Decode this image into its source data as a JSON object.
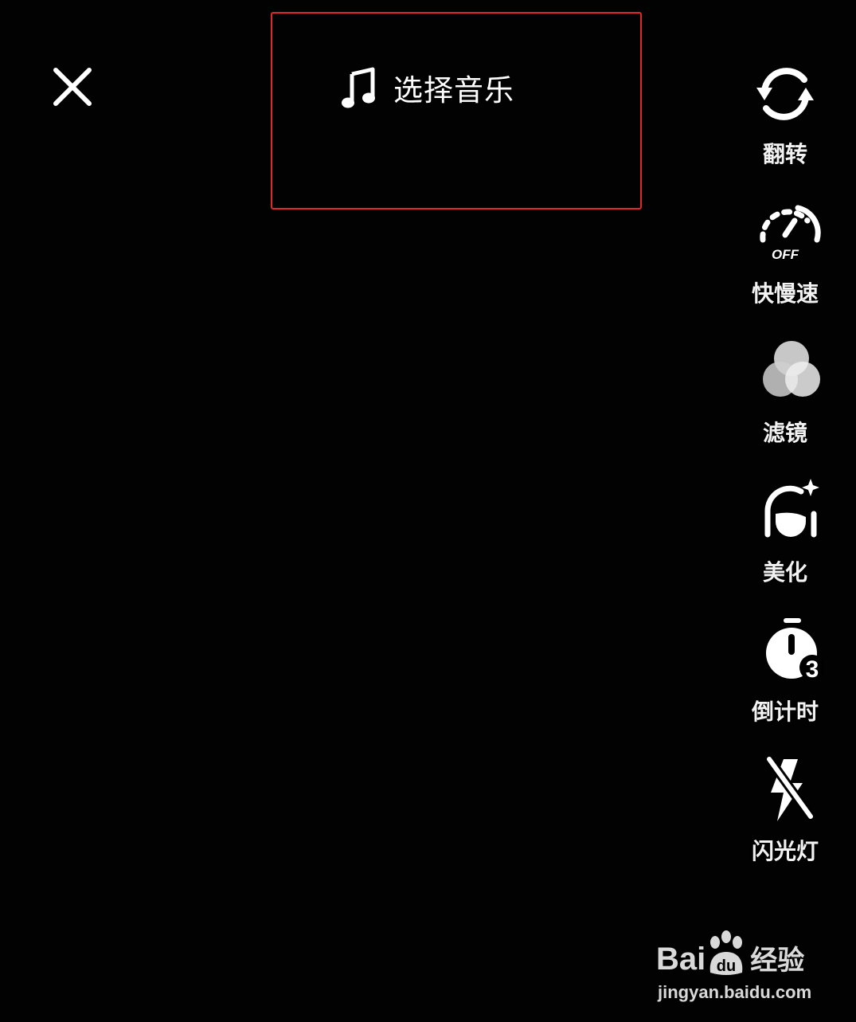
{
  "top_bar": {
    "music_label": "选择音乐"
  },
  "side_tools": [
    {
      "id": "flip",
      "label": "翻转",
      "icon": "flip-camera-icon"
    },
    {
      "id": "speed",
      "label": "快慢速",
      "icon": "speed-gauge-icon",
      "icon_badge": "OFF"
    },
    {
      "id": "filter",
      "label": "滤镜",
      "icon": "filter-circles-icon"
    },
    {
      "id": "beautify",
      "label": "美化",
      "icon": "beautify-face-icon"
    },
    {
      "id": "countdown",
      "label": "倒计时",
      "icon": "countdown-timer-icon",
      "icon_badge": "3"
    },
    {
      "id": "flash",
      "label": "闪光灯",
      "icon": "flash-off-icon"
    }
  ],
  "watermark": {
    "brand_prefix": "Bai",
    "brand_suffix": "经验",
    "paw_text": "du",
    "url": "jingyan.baidu.com"
  },
  "colors": {
    "background": "#020202",
    "foreground": "#ffffff",
    "highlight_border": "#e0282c"
  }
}
